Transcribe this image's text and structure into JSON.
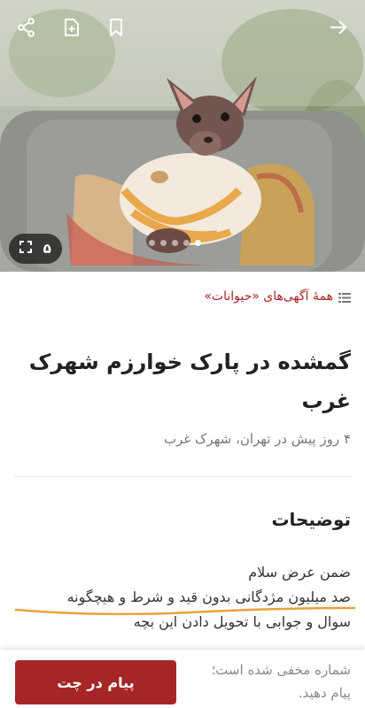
{
  "hero": {
    "photo_count": "۵",
    "dots_total": 5,
    "dots_active_index": 4,
    "icons": [
      "share-icon",
      "add-note-icon",
      "bookmark-icon",
      "back-arrow-icon",
      "fullscreen-icon"
    ]
  },
  "breadcrumb": {
    "label": "همهٔ آگهی‌های «حیوانات»"
  },
  "listing": {
    "title": "گمشده در پارک خوارزم شهرک غرب",
    "meta": "۴ روز پیش در تهران، شهرک غرب"
  },
  "description": {
    "heading": "توضیحات",
    "lines": [
      "ضمن عرض سلام",
      "صد میلیون مژدگانی بدون قید و شرط و هیچگونه",
      "سوال و جوابی با تحویل دادن این بچه"
    ]
  },
  "bottom_bar": {
    "chat_label": "پیام در چت",
    "hidden_note": "شماره مخفی شده است؛ پیام دهید."
  },
  "colors": {
    "accent": "#a62626",
    "underline": "#e8a33b"
  }
}
